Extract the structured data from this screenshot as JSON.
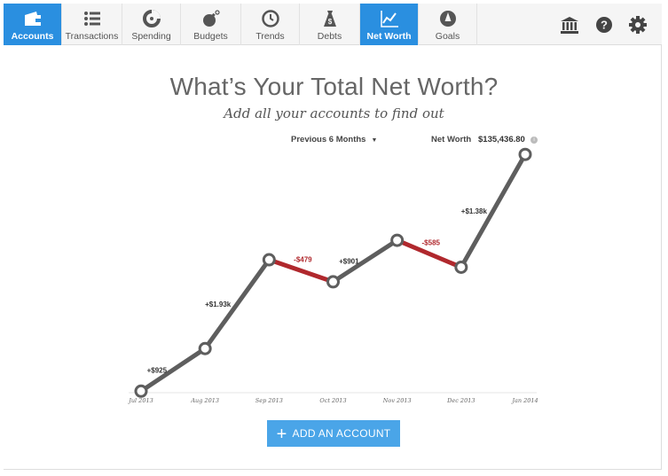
{
  "nav": {
    "tabs": [
      {
        "label": "Accounts",
        "icon": "wallet-icon",
        "active": true
      },
      {
        "label": "Transactions",
        "icon": "list-icon",
        "active": false
      },
      {
        "label": "Spending",
        "icon": "pie-chart-icon",
        "active": false
      },
      {
        "label": "Budgets",
        "icon": "bomb-icon",
        "active": false
      },
      {
        "label": "Trends",
        "icon": "clock-icon",
        "active": false
      },
      {
        "label": "Debts",
        "icon": "money-bag-icon",
        "active": false
      },
      {
        "label": "Net Worth",
        "icon": "line-chart-icon",
        "active": true
      },
      {
        "label": "Goals",
        "icon": "compass-icon",
        "active": false
      }
    ],
    "utility_icons": [
      "bank-icon",
      "help-icon",
      "gear-icon"
    ]
  },
  "page": {
    "title": "What’s Your Total Net Worth?",
    "subtitle": "Add all your accounts to find out"
  },
  "controls": {
    "period_label": "Previous 6 Months",
    "net_worth_label": "Net Worth",
    "net_worth_value": "$135,436.80"
  },
  "chart_data": {
    "type": "line",
    "x": [
      "Jul 2013",
      "Aug 2013",
      "Sep 2013",
      "Oct 2013",
      "Nov 2013",
      "Dec 2013",
      "Jan 2014"
    ],
    "y": [
      130295,
      131220,
      133150,
      132671,
      133572,
      132987,
      135437
    ],
    "change_labels": [
      "+$925",
      "+$1.93k",
      "-$479",
      "+$901",
      "-$585",
      "+$1.38k"
    ],
    "colors": {
      "increase": "#5e5e5e",
      "decrease": "#b0282d"
    },
    "ylim": [
      129800,
      136000
    ]
  },
  "cta": {
    "label": "ADD AN ACCOUNT"
  }
}
